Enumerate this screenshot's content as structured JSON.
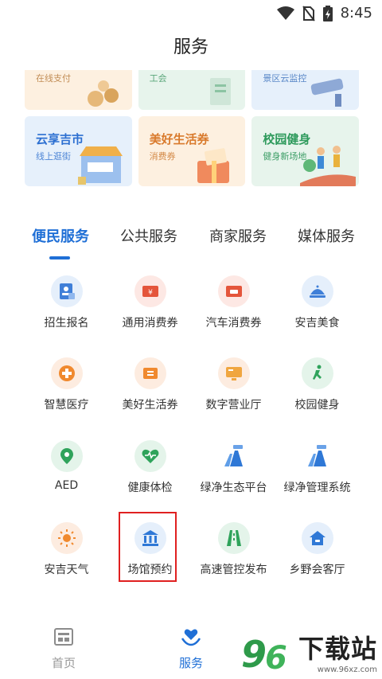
{
  "status": {
    "time": "8:45"
  },
  "header": {
    "title": "服务"
  },
  "banners_top": [
    {
      "subtitle": "在线支付"
    },
    {
      "subtitle": "工会"
    },
    {
      "subtitle": "景区云监控"
    }
  ],
  "banners": [
    {
      "title": "云享吉市",
      "subtitle": "线上逛街"
    },
    {
      "title": "美好生活券",
      "subtitle": "消费券"
    },
    {
      "title": "校园健身",
      "subtitle": "健身新场地"
    }
  ],
  "tabs": [
    {
      "label": "便民服务"
    },
    {
      "label": "公共服务"
    },
    {
      "label": "商家服务"
    },
    {
      "label": "媒体服务"
    }
  ],
  "services": [
    {
      "label": "招生报名",
      "icon": "enrollment-icon"
    },
    {
      "label": "通用消费券",
      "icon": "coupon-icon"
    },
    {
      "label": "汽车消费券",
      "icon": "car-coupon-icon"
    },
    {
      "label": "安吉美食",
      "icon": "food-icon"
    },
    {
      "label": "智慧医疗",
      "icon": "medical-icon"
    },
    {
      "label": "美好生活券",
      "icon": "ticket-icon"
    },
    {
      "label": "数字营业厅",
      "icon": "tv-icon"
    },
    {
      "label": "校园健身",
      "icon": "running-icon"
    },
    {
      "label": "AED",
      "icon": "location-pin-icon"
    },
    {
      "label": "健康体检",
      "icon": "heart-pulse-icon"
    },
    {
      "label": "绿净生态平台",
      "icon": "road-icon"
    },
    {
      "label": "绿净管理系统",
      "icon": "road-icon"
    },
    {
      "label": "安吉天气",
      "icon": "sun-icon"
    },
    {
      "label": "场馆预约",
      "icon": "venue-icon"
    },
    {
      "label": "高速管控发布",
      "icon": "highway-icon"
    },
    {
      "label": "乡野会客厅",
      "icon": "house-icon"
    }
  ],
  "nav": [
    {
      "label": "首页"
    },
    {
      "label": "服务"
    }
  ],
  "watermark": {
    "text": "下载站",
    "url": "www.96xz.com"
  },
  "colors": {
    "accent": "#1f6fd6",
    "highlight": "#e02020"
  }
}
